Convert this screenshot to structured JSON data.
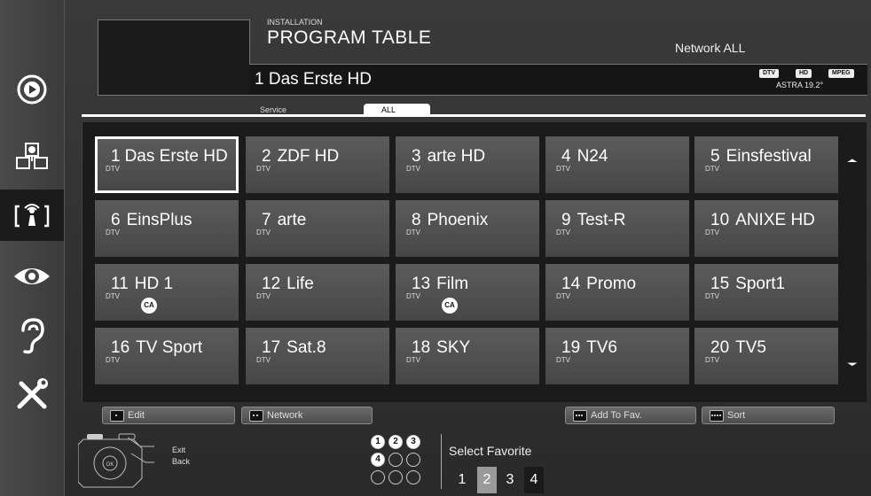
{
  "header": {
    "section": "INSTALLATION",
    "title": "PROGRAM TABLE",
    "network": "Network ALL",
    "current_channel": "1  Das Erste HD",
    "badges": [
      "DTV",
      "HD",
      "MPEG"
    ],
    "satellite": "ASTRA 19.2°"
  },
  "tabs": [
    {
      "label": "Service",
      "active": false
    },
    {
      "label": "ALL",
      "active": true
    }
  ],
  "channels": [
    {
      "num": "1",
      "name": "Das Erste HD",
      "type": "DTV",
      "ca": false,
      "selected": true
    },
    {
      "num": "2",
      "name": "ZDF HD",
      "type": "DTV",
      "ca": false
    },
    {
      "num": "3",
      "name": "arte HD",
      "type": "DTV",
      "ca": false
    },
    {
      "num": "4",
      "name": "N24",
      "type": "DTV",
      "ca": false
    },
    {
      "num": "5",
      "name": "Einsfestival",
      "type": "DTV",
      "ca": false
    },
    {
      "num": "6",
      "name": "EinsPlus",
      "type": "DTV",
      "ca": false
    },
    {
      "num": "7",
      "name": "arte",
      "type": "DTV",
      "ca": false
    },
    {
      "num": "8",
      "name": "Phoenix",
      "type": "DTV",
      "ca": false
    },
    {
      "num": "9",
      "name": "Test-R",
      "type": "DTV",
      "ca": false
    },
    {
      "num": "10",
      "name": "ANIXE HD",
      "type": "DTV",
      "ca": false
    },
    {
      "num": "11",
      "name": "HD 1",
      "type": "DTV",
      "ca": true
    },
    {
      "num": "12",
      "name": "Life",
      "type": "DTV",
      "ca": false
    },
    {
      "num": "13",
      "name": "Film",
      "type": "DTV",
      "ca": true
    },
    {
      "num": "14",
      "name": "Promo",
      "type": "DTV",
      "ca": false
    },
    {
      "num": "15",
      "name": "Sport1",
      "type": "DTV",
      "ca": false
    },
    {
      "num": "16",
      "name": "TV Sport",
      "type": "DTV",
      "ca": false
    },
    {
      "num": "17",
      "name": "Sat.8",
      "type": "DTV",
      "ca": false
    },
    {
      "num": "18",
      "name": "SKY",
      "type": "DTV",
      "ca": false
    },
    {
      "num": "19",
      "name": "TV6",
      "type": "DTV",
      "ca": false
    },
    {
      "num": "20",
      "name": "TV5",
      "type": "DTV",
      "ca": false
    }
  ],
  "ca_label": "CA",
  "actions": [
    {
      "label": "Edit",
      "dots": 1
    },
    {
      "label": "Network",
      "dots": 2
    },
    {
      "label": "Add To Fav.",
      "dots": 3
    },
    {
      "label": "Sort",
      "dots": 4
    }
  ],
  "remote": {
    "ok": "OK",
    "exit": "Exit",
    "back": "Back"
  },
  "favorites": {
    "label": "Select Favorite",
    "keys": [
      "1",
      "2",
      "3",
      "4"
    ],
    "number_circles": [
      "1",
      "2",
      "3",
      "4",
      "",
      "",
      "",
      "",
      ""
    ]
  },
  "colors": {
    "tile": "#525252",
    "panel": "#1b1b1b",
    "fav2": "#9a9a9a",
    "fav4": "#1a1a1a"
  },
  "sidebar": {
    "icons": [
      "media-icon",
      "network-source-icon",
      "installation-icon",
      "picture-icon",
      "sound-icon",
      "tools-icon"
    ]
  }
}
